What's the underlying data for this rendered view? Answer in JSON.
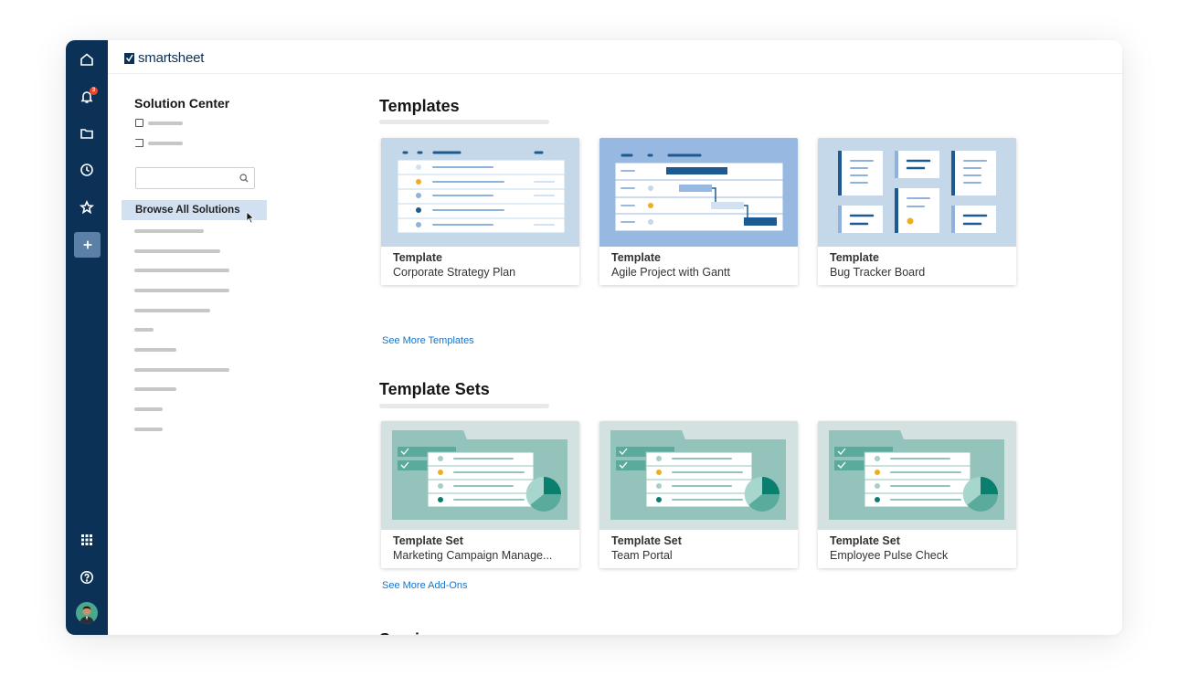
{
  "app": {
    "logo_text": "smartsheet"
  },
  "rail": {
    "items": [
      {
        "name": "home",
        "icon": "home-icon"
      },
      {
        "name": "notifications",
        "icon": "bell-icon",
        "badge": "3"
      },
      {
        "name": "browse",
        "icon": "folder-icon"
      },
      {
        "name": "recents",
        "icon": "clock-icon"
      },
      {
        "name": "favorites",
        "icon": "star-icon"
      },
      {
        "name": "create",
        "icon": "plus-icon"
      }
    ],
    "bottom": [
      {
        "name": "launcher",
        "icon": "grid-icon"
      },
      {
        "name": "help",
        "icon": "help-icon"
      },
      {
        "name": "account",
        "icon": "avatar"
      }
    ]
  },
  "sidepanel": {
    "title": "Solution Center",
    "search": {
      "value": "",
      "placeholder": ""
    },
    "browse_label": "Browse All Solutions"
  },
  "main": {
    "templates": {
      "title": "Templates",
      "see_more": "See More Templates",
      "cards": [
        {
          "kind": "Template",
          "name": "Corporate Strategy Plan"
        },
        {
          "kind": "Template",
          "name": "Agile Project with Gantt"
        },
        {
          "kind": "Template",
          "name": "Bug Tracker Board"
        }
      ]
    },
    "template_sets": {
      "title": "Template Sets",
      "see_more": "See More Add-Ons",
      "cards": [
        {
          "kind": "Template Set",
          "name": "Marketing Campaign Manage..."
        },
        {
          "kind": "Template Set",
          "name": "Team Portal"
        },
        {
          "kind": "Template Set",
          "name": "Employee Pulse Check"
        }
      ]
    },
    "services": {
      "title": "Services"
    }
  },
  "colors": {
    "rail": "#0b3157",
    "accent_link": "#1a73c6",
    "selected_bg": "#d2e1f1",
    "badge": "#e3492f",
    "template_thumb": "#c5d8ea",
    "gantt_thumb": "#97b8e0",
    "set_thumb": "#d3e2e0"
  }
}
